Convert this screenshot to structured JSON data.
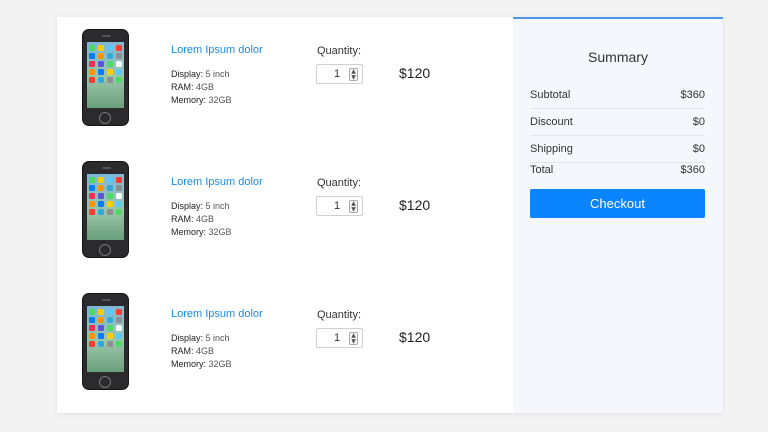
{
  "cart": {
    "items": [
      {
        "title": "Lorem Ipsum dolor",
        "display_label": "Display:",
        "display_value": "5 inch",
        "ram_label": "RAM:",
        "ram_value": "4GB",
        "memory_label": "Memory:",
        "memory_value": "32GB",
        "quantity_label": "Quantity:",
        "quantity": "1",
        "price": "$120"
      },
      {
        "title": "Lorem Ipsum dolor",
        "display_label": "Display:",
        "display_value": "5 inch",
        "ram_label": "RAM:",
        "ram_value": "4GB",
        "memory_label": "Memory:",
        "memory_value": "32GB",
        "quantity_label": "Quantity:",
        "quantity": "1",
        "price": "$120"
      },
      {
        "title": "Lorem Ipsum dolor",
        "display_label": "Display:",
        "display_value": "5 inch",
        "ram_label": "RAM:",
        "ram_value": "4GB",
        "memory_label": "Memory:",
        "memory_value": "32GB",
        "quantity_label": "Quantity:",
        "quantity": "1",
        "price": "$120"
      }
    ],
    "item_image_icon": "smartphone-icon",
    "spinner_up_icon": "chevron-up-icon",
    "spinner_down_icon": "chevron-down-icon"
  },
  "summary": {
    "title": "Summary",
    "subtotal_label": "Subtotal",
    "subtotal_value": "$360",
    "discount_label": "Discount",
    "discount_value": "$0",
    "shipping_label": "Shipping",
    "shipping_value": "$0",
    "total_label": "Total",
    "total_value": "$360",
    "checkout_label": "Checkout"
  },
  "colors": {
    "accent": "#0a84ff",
    "link": "#1a8ce6",
    "summary_bg": "#f4f7fb",
    "page_bg": "#f3f3f3"
  }
}
